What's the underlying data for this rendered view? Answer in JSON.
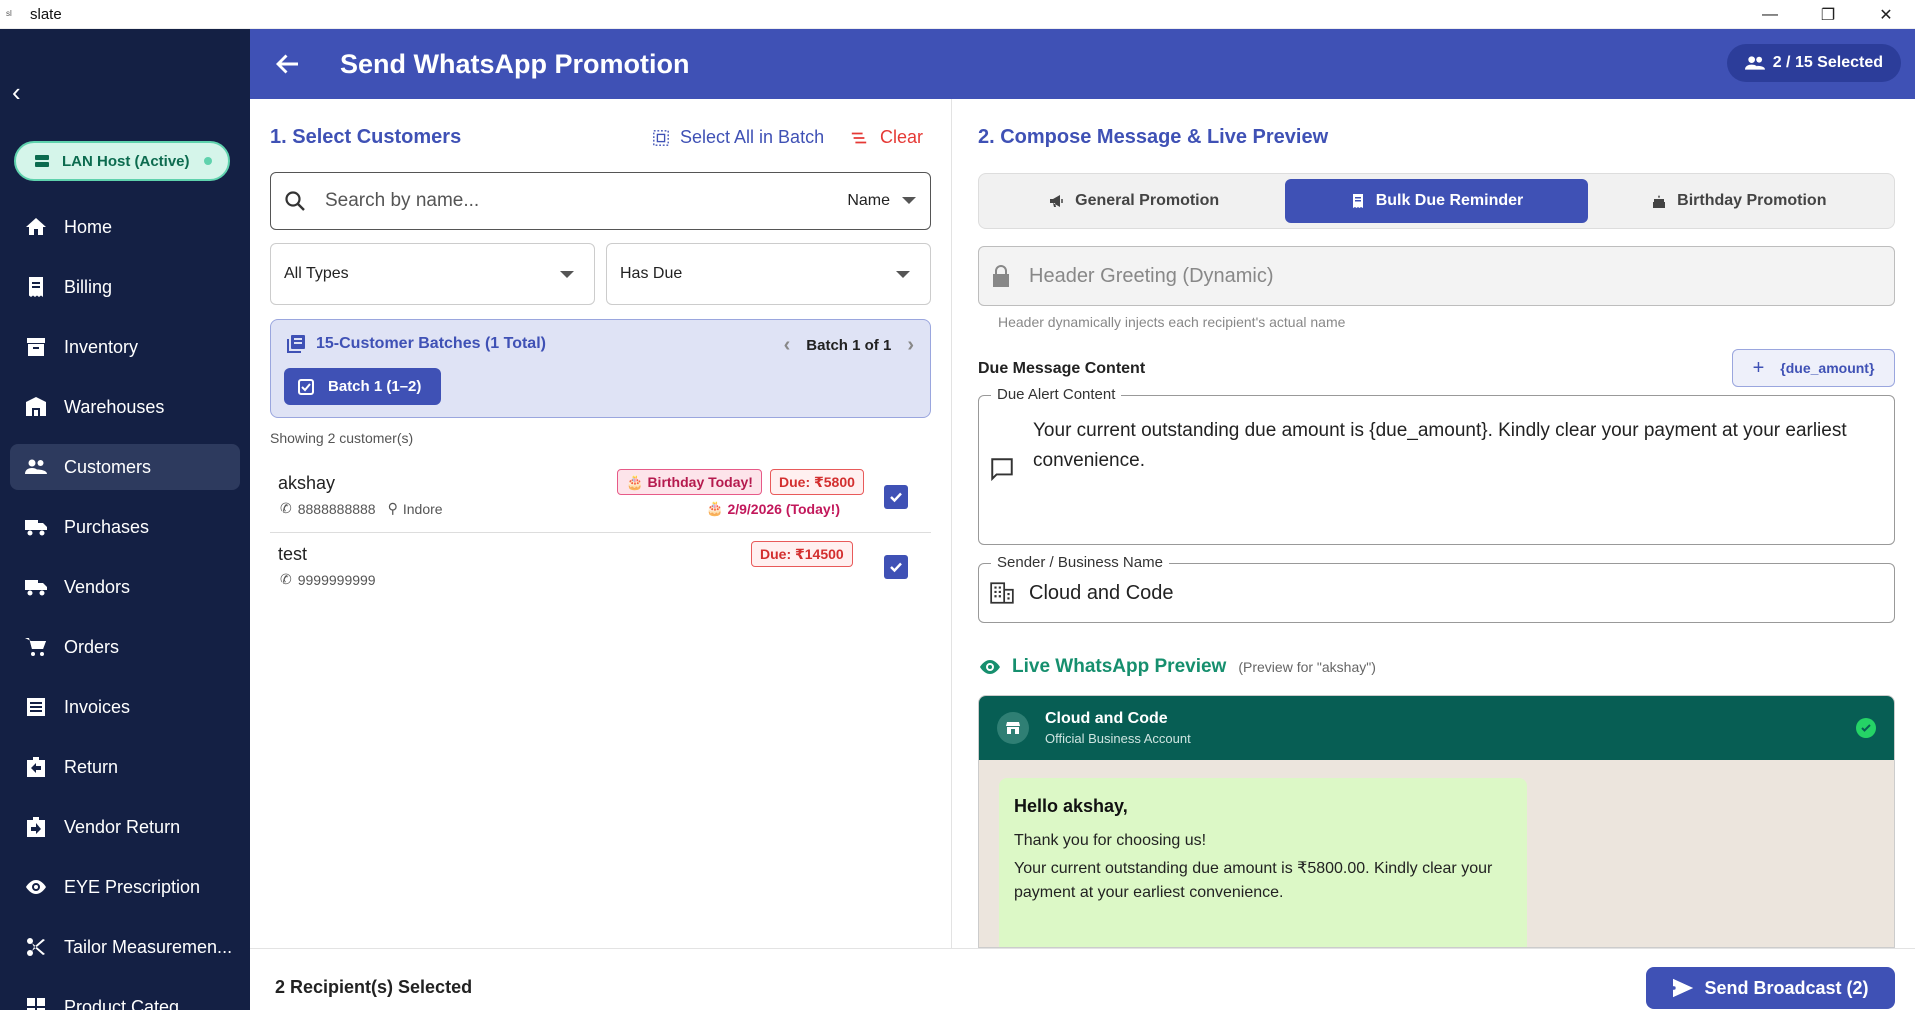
{
  "window": {
    "title": "slate",
    "icon_text": "sl"
  },
  "sidebar": {
    "lan_status": "LAN Host (Active)",
    "items": [
      {
        "label": "Home",
        "icon": "home-icon",
        "active": false
      },
      {
        "label": "Billing",
        "icon": "receipt-icon",
        "active": false
      },
      {
        "label": "Inventory",
        "icon": "archive-icon",
        "active": false
      },
      {
        "label": "Warehouses",
        "icon": "warehouse-icon",
        "active": false
      },
      {
        "label": "Customers",
        "icon": "people-icon",
        "active": true
      },
      {
        "label": "Purchases",
        "icon": "truck-icon",
        "active": false
      },
      {
        "label": "Vendors",
        "icon": "truck-icon",
        "active": false
      },
      {
        "label": "Orders",
        "icon": "cart-icon",
        "active": false
      },
      {
        "label": "Invoices",
        "icon": "list-icon",
        "active": false
      },
      {
        "label": "Return",
        "icon": "return-icon",
        "active": false
      },
      {
        "label": "Vendor Return",
        "icon": "vendor-return-icon",
        "active": false
      },
      {
        "label": "EYE Prescription",
        "icon": "eye-icon",
        "active": false
      },
      {
        "label": "Tailor Measuremen...",
        "icon": "scissors-icon",
        "active": false
      },
      {
        "label": "Product Categ...",
        "icon": "category-icon",
        "active": false
      }
    ]
  },
  "header": {
    "title": "Send WhatsApp Promotion",
    "selected_label": "2 / 15 Selected"
  },
  "left": {
    "section_title": "1. Select Customers",
    "select_all_label": "Select All in Batch",
    "clear_label": "Clear",
    "search_placeholder": "Search by name...",
    "sort_value": "Name",
    "type_filter": "All Types",
    "due_filter": "Has Due",
    "batch_title": "15-Customer Batches (1 Total)",
    "batch_nav": "Batch 1 of 1",
    "batch_chip": "Batch 1 (1–2)",
    "showing": "Showing 2 customer(s)",
    "customers": [
      {
        "name": "akshay",
        "phone": "8888888888",
        "city": "Indore",
        "birthday_badge": "Birthday Today!",
        "due_badge": "Due: ₹5800",
        "birthday_date": "2/9/2026 (Today!)",
        "checked": true
      },
      {
        "name": "test",
        "phone": "9999999999",
        "due_badge": "Due: ₹14500",
        "checked": true
      }
    ]
  },
  "right": {
    "section_title": "2. Compose Message & Live Preview",
    "tabs": [
      {
        "label": "General Promotion",
        "icon": "megaphone-icon",
        "active": false
      },
      {
        "label": "Bulk Due Reminder",
        "icon": "receipt-icon",
        "active": true
      },
      {
        "label": "Birthday Promotion",
        "icon": "cake-icon",
        "active": false
      }
    ],
    "header_greeting_placeholder": "Header Greeting (Dynamic)",
    "header_hint": "Header dynamically injects each recipient's actual name",
    "due_content_label": "Due Message Content",
    "insert_tag_label": "{due_amount}",
    "due_alert_legend": "Due Alert Content",
    "due_alert_text": "Your current outstanding due amount is {due_amount}. Kindly clear your payment at your earliest convenience.",
    "sender_legend": "Sender / Business Name",
    "sender_value": "Cloud and Code",
    "preview_title": "Live WhatsApp Preview",
    "preview_for": "(Preview for \"akshay\")",
    "wa_name": "Cloud and Code",
    "wa_subtitle": "Official Business Account",
    "bubble_hello": "Hello akshay,",
    "bubble_line1": "Thank you for choosing us!",
    "bubble_line2": "Your current outstanding due amount is ₹5800.00. Kindly clear your payment at your earliest convenience."
  },
  "footer": {
    "recipients": "2 Recipient(s) Selected",
    "send_label": "Send Broadcast (2)"
  },
  "colors": {
    "primary": "#3f51b5",
    "sidebar": "#142044",
    "whatsapp_green": "#075e54",
    "bubble": "#dcf8c6",
    "accent_green": "#168f6e",
    "danger": "#d32f2f"
  }
}
